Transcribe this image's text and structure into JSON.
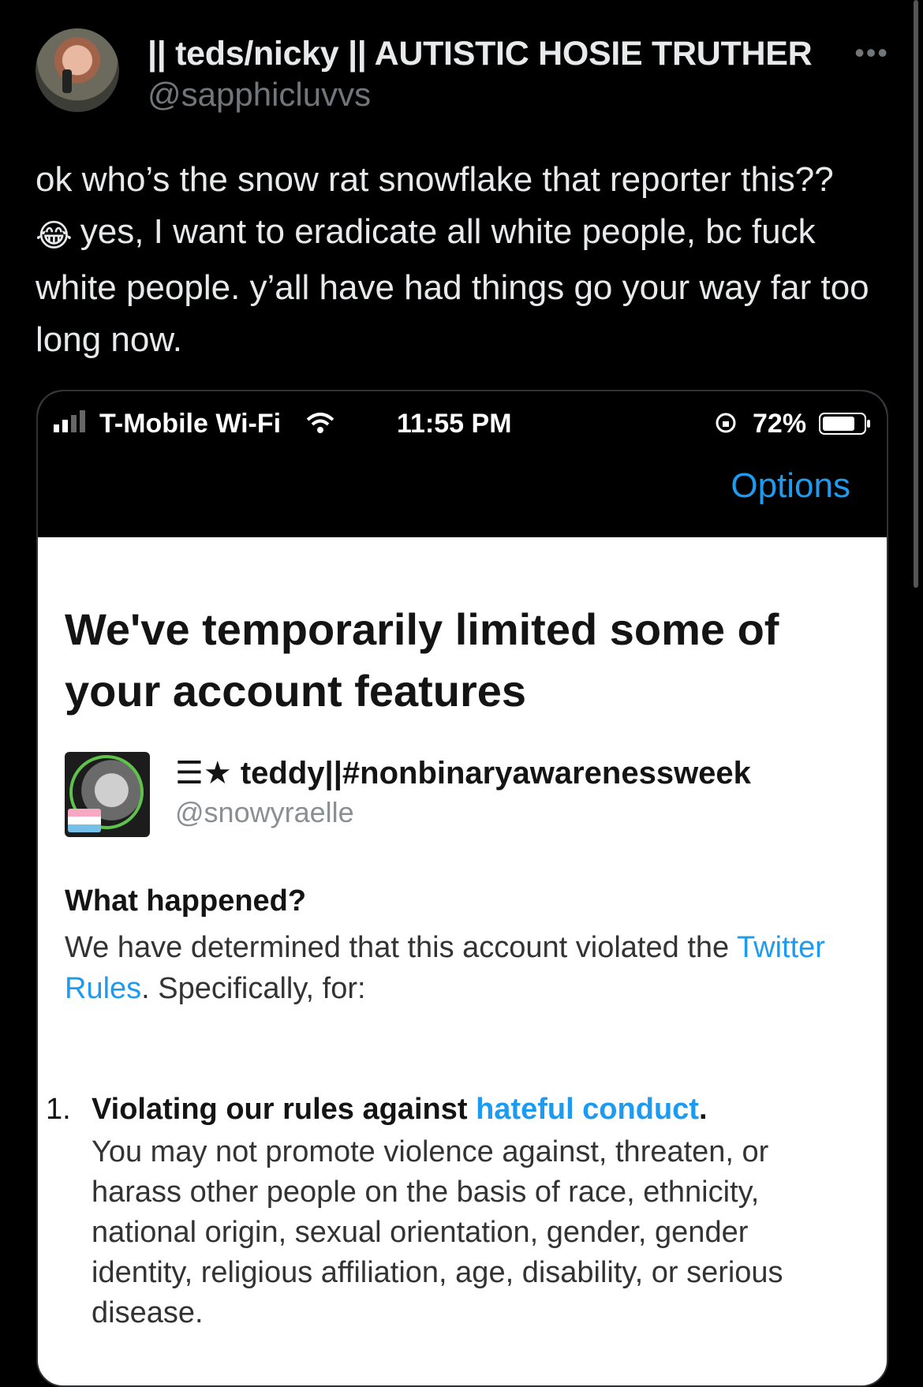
{
  "tweet": {
    "display_name": "|| teds/nicky || AUTISTIC HOSIE TRUTHER",
    "handle": "@sapphicluvvs",
    "more_icon": "more-horizontal-icon",
    "text_line1": "ok who’s the snow rat snowflake that reporter this??",
    "emoji": "😂",
    "text_rest": "yes, I want to eradicate all white people, bc fuck white people. y’all have had things go your way far too long now."
  },
  "screenshot": {
    "status_bar": {
      "carrier": "T-Mobile Wi-Fi",
      "time": "11:55 PM",
      "battery": "72%"
    },
    "options_label": "Options",
    "headline": "We've temporarily limited some of your account features",
    "account": {
      "name": "☰★ teddy||#nonbinaryawarenessweek",
      "handle": "@snowyraelle"
    },
    "what_happened_title": "What happened?",
    "what_happened_prefix": "We have determined that this account violated the ",
    "rules_link": "Twitter Rules",
    "what_happened_suffix": ". Specifically, for:",
    "rule": {
      "number": "1.",
      "title_prefix": "Violating our rules against ",
      "title_link": "hateful conduct",
      "title_suffix": ".",
      "body": "You may not promote violence against, threaten, or harass other people on the basis of race, ethnicity, national origin, sexual orientation, gender, gender identity, religious affiliation, age, disability, or serious disease."
    }
  },
  "colors": {
    "background": "#000000",
    "text": "#e7e9ea",
    "muted": "#71767b",
    "link": "#1d9bf0"
  }
}
